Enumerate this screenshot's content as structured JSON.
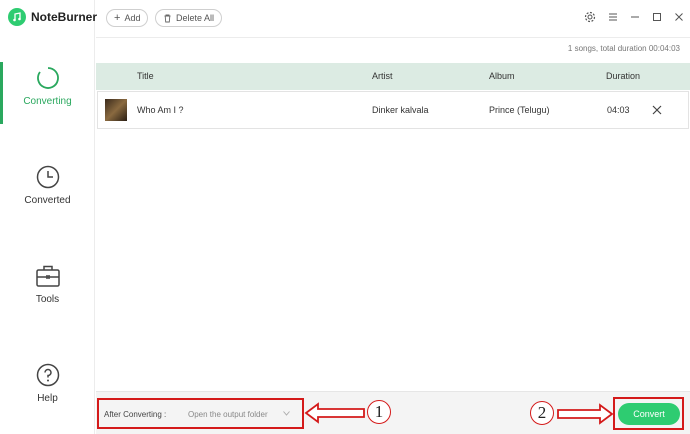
{
  "app": {
    "name": "NoteBurner"
  },
  "sidebar": {
    "items": [
      {
        "label": "Converting",
        "icon": "converting-icon"
      },
      {
        "label": "Converted",
        "icon": "clock-icon"
      },
      {
        "label": "Tools",
        "icon": "toolbox-icon"
      },
      {
        "label": "Help",
        "icon": "help-icon"
      }
    ]
  },
  "toolbar": {
    "add_label": "Add",
    "delete_all_label": "Delete All"
  },
  "summary": "1 songs, total duration 00:04:03",
  "table": {
    "headers": {
      "title": "Title",
      "artist": "Artist",
      "album": "Album",
      "duration": "Duration"
    },
    "rows": [
      {
        "title": "Who Am I ?",
        "artist": "Dinker kalvala",
        "album": "Prince (Telugu)",
        "duration": "04:03"
      }
    ]
  },
  "footer": {
    "after_converting_label": "After Converting :",
    "after_converting_value": "Open the output folder",
    "convert_label": "Convert"
  },
  "annotations": {
    "marker1": "1",
    "marker2": "2"
  },
  "colors": {
    "accent": "#2ecc71",
    "annotation": "#d41a1a"
  }
}
